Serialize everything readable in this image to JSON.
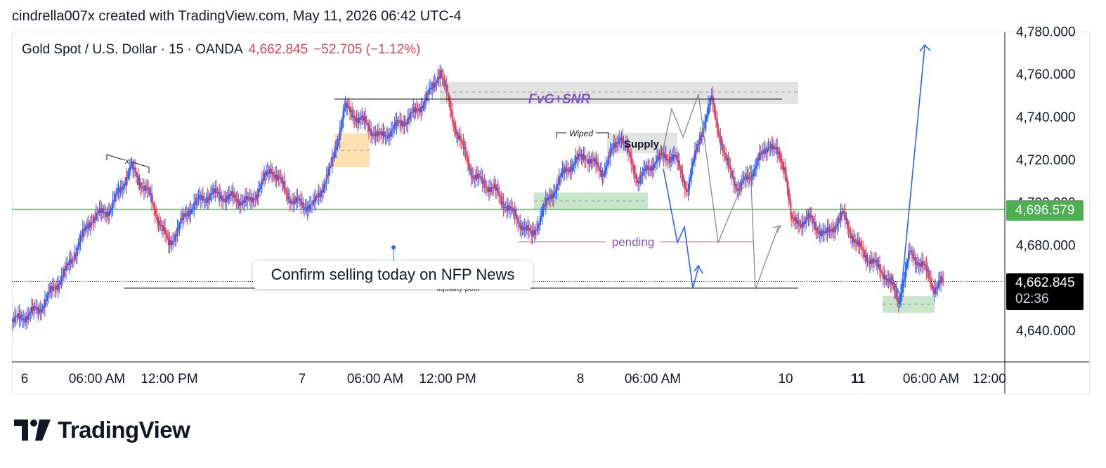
{
  "credit": "cindrella007x created with TradingView.com, May 11, 2026 06:42 UTC-4",
  "legend": {
    "symbol": "Gold Spot / U.S. Dollar · 15 · OANDA",
    "price": "4,662.845",
    "change": "−52.705 (−1.12%)"
  },
  "brand": {
    "name": "TradingView",
    "logo_icon": "tradingview-logo-icon"
  },
  "colors": {
    "up": "#2962ff",
    "down": "#e0405a",
    "support": "#81c784",
    "tag_green": "#4caf50",
    "annotation": "#7e57c2"
  },
  "tags": {
    "support_price": "4,696.579",
    "last_price": "4,662.845",
    "countdown": "02:36"
  },
  "callout": {
    "text": "Confirm selling today on NFP News"
  },
  "annotations": {
    "fvg_snr": "FvG+SNR",
    "supply": "Supply",
    "wiped": "Wiped",
    "pending": "pending",
    "liquidity_pool": "liquidity pool",
    "x_mark": "x"
  },
  "chart_data": {
    "type": "candlestick",
    "title": "Gold Spot / U.S. Dollar · 15 · OANDA",
    "ylim": [
      4626,
      4780
    ],
    "y_ticks": [
      "4,640.000",
      "4,680.000",
      "4,700.000",
      "4,720.000",
      "4,740.000",
      "4,760.000",
      "4,780.000"
    ],
    "y_tick_values": [
      4640,
      4680,
      4700,
      4720,
      4740,
      4760,
      4780
    ],
    "x_ticks": [
      "6",
      "06:00 AM",
      "12:00 PM",
      "7",
      "06:00 AM",
      "12:00 PM",
      "8",
      "06:00 AM",
      "10",
      "11",
      "06:00 AM",
      "12:00"
    ],
    "x_tick_bold": [
      "11"
    ],
    "grid": false,
    "support_level": 4696.579,
    "last_price": 4662.845,
    "close_path": [
      {
        "i": 0,
        "price": 4644
      },
      {
        "i": 24,
        "price": 4650
      },
      {
        "i": 48,
        "price": 4668
      },
      {
        "i": 70,
        "price": 4692
      },
      {
        "i": 88,
        "price": 4697
      },
      {
        "i": 106,
        "price": 4716
      },
      {
        "i": 122,
        "price": 4704
      },
      {
        "i": 140,
        "price": 4680
      },
      {
        "i": 160,
        "price": 4698
      },
      {
        "i": 178,
        "price": 4704
      },
      {
        "i": 196,
        "price": 4702
      },
      {
        "i": 214,
        "price": 4700
      },
      {
        "i": 232,
        "price": 4716
      },
      {
        "i": 252,
        "price": 4700
      },
      {
        "i": 270,
        "price": 4698
      },
      {
        "i": 286,
        "price": 4716
      },
      {
        "i": 298,
        "price": 4744
      },
      {
        "i": 314,
        "price": 4738
      },
      {
        "i": 330,
        "price": 4730
      },
      {
        "i": 346,
        "price": 4736
      },
      {
        "i": 362,
        "price": 4742
      },
      {
        "i": 376,
        "price": 4752
      },
      {
        "i": 384,
        "price": 4762
      },
      {
        "i": 398,
        "price": 4734
      },
      {
        "i": 414,
        "price": 4712
      },
      {
        "i": 432,
        "price": 4706
      },
      {
        "i": 450,
        "price": 4694
      },
      {
        "i": 466,
        "price": 4684
      },
      {
        "i": 482,
        "price": 4702
      },
      {
        "i": 498,
        "price": 4716
      },
      {
        "i": 514,
        "price": 4722
      },
      {
        "i": 530,
        "price": 4714
      },
      {
        "i": 546,
        "price": 4732
      },
      {
        "i": 562,
        "price": 4710
      },
      {
        "i": 578,
        "price": 4720
      },
      {
        "i": 594,
        "price": 4722
      },
      {
        "i": 606,
        "price": 4706
      },
      {
        "i": 618,
        "price": 4732
      },
      {
        "i": 628,
        "price": 4748
      },
      {
        "i": 640,
        "price": 4720
      },
      {
        "i": 652,
        "price": 4706
      },
      {
        "i": 664,
        "price": 4714
      },
      {
        "i": 680,
        "price": 4728
      },
      {
        "i": 694,
        "price": 4716
      },
      {
        "i": 700,
        "price": 4690
      },
      {
        "i": 716,
        "price": 4692
      },
      {
        "i": 730,
        "price": 4684
      },
      {
        "i": 746,
        "price": 4694
      },
      {
        "i": 758,
        "price": 4680
      },
      {
        "i": 772,
        "price": 4672
      },
      {
        "i": 784,
        "price": 4666
      },
      {
        "i": 796,
        "price": 4654
      },
      {
        "i": 806,
        "price": 4676
      },
      {
        "i": 818,
        "price": 4670
      },
      {
        "i": 828,
        "price": 4660
      },
      {
        "i": 836,
        "price": 4663
      }
    ]
  }
}
